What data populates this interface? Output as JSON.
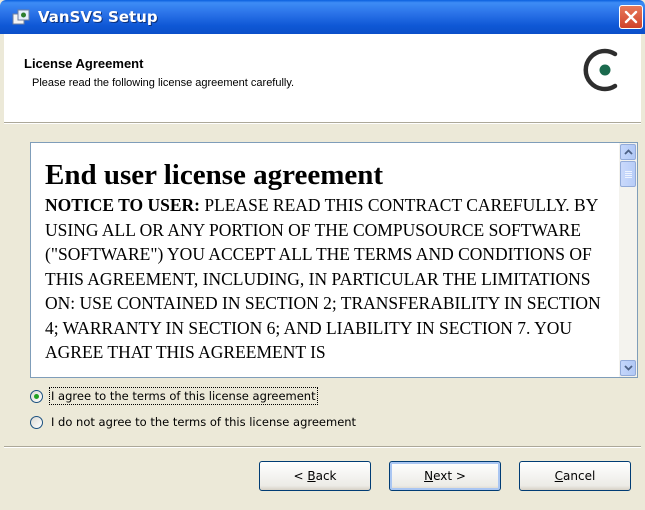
{
  "window": {
    "title": "VanSVS Setup",
    "close_icon": "close-icon"
  },
  "header": {
    "title": "License Agreement",
    "subtitle": "Please read the following license agreement carefully."
  },
  "license": {
    "heading": "End user license agreement",
    "notice_label": "NOTICE TO USER:",
    "body": "PLEASE READ THIS CONTRACT CAREFULLY. BY USING ALL OR ANY PORTION OF THE COMPUSOURCE SOFTWARE (\"SOFTWARE\") YOU ACCEPT ALL THE TERMS AND CONDITIONS OF THIS AGREEMENT, INCLUDING, IN PARTICULAR THE LIMITATIONS ON: USE CONTAINED IN SECTION 2; TRANSFERABILITY IN SECTION 4; WARRANTY IN SECTION 6; AND LIABILITY IN SECTION 7. YOU AGREE THAT THIS AGREEMENT IS"
  },
  "options": {
    "agree": {
      "label": "I agree to the terms of this license agreement",
      "selected": true
    },
    "disagree": {
      "label": "I do not agree to the terms of this license agreement",
      "selected": false
    }
  },
  "buttons": {
    "back": {
      "mnemonic": "B",
      "rest": "ack",
      "prefix": "< "
    },
    "next": {
      "mnemonic": "N",
      "rest": "ext >"
    },
    "cancel": {
      "mnemonic": "C",
      "rest": "ancel"
    }
  },
  "colors": {
    "titlebar": "#0b4fc9",
    "radio_selected": "#21a121",
    "window_bg": "#ece9d8"
  }
}
